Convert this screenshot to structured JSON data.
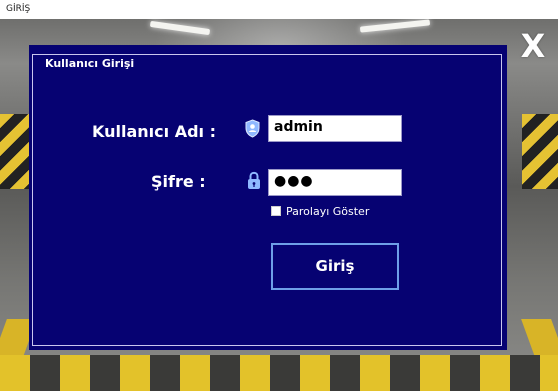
{
  "window": {
    "title": "GİRİŞ"
  },
  "close_button": {
    "label": "X"
  },
  "login_panel": {
    "group_title": "Kullanıcı Girişi",
    "username_label": "Kullanıcı Adı :",
    "username_value": "admin",
    "username_icon": "user-shield-icon",
    "password_label": "Şifre :",
    "password_value": "●●●",
    "password_icon": "padlock-icon",
    "show_password_label": "Parolayı Göster",
    "show_password_checked": false,
    "login_button_label": "Giriş"
  },
  "colors": {
    "panel_background": "#060272",
    "button_border": "#6e9fe8",
    "text": "#ffffff"
  }
}
